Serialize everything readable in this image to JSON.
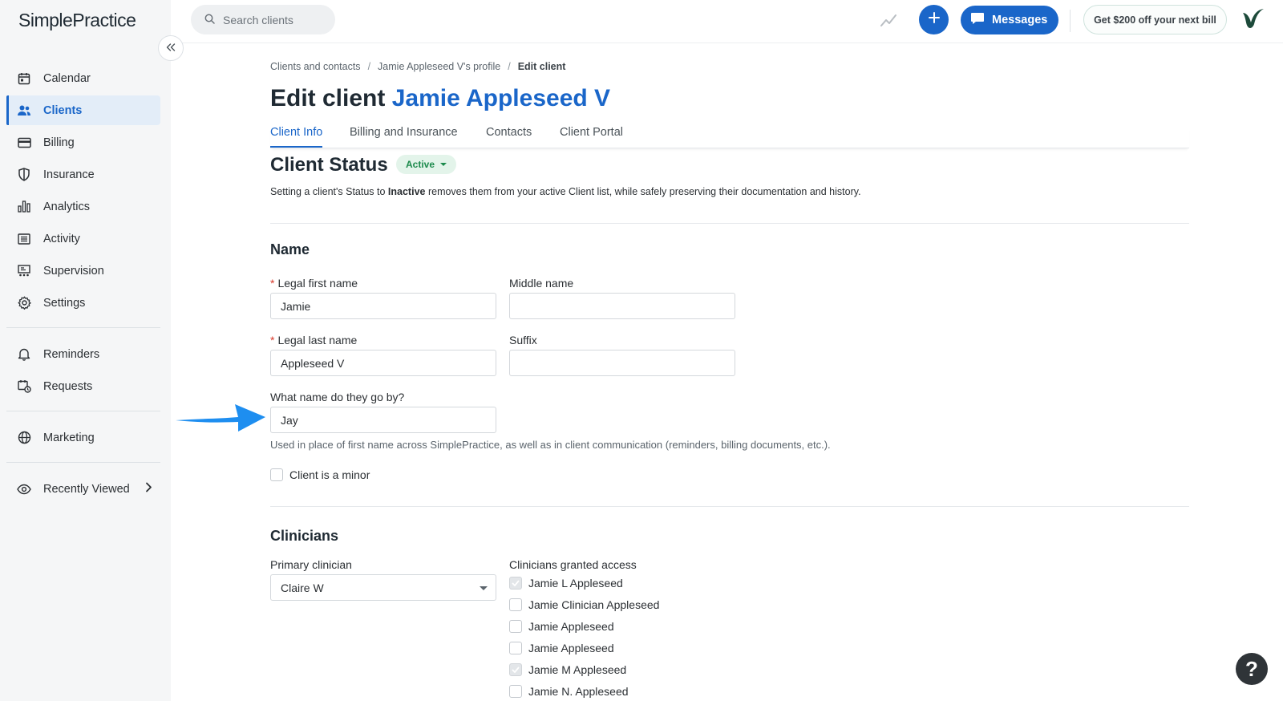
{
  "app": {
    "logo": "SimplePractice",
    "search_placeholder": "Search clients",
    "messages_label": "Messages",
    "promo_label": "Get $200 off your next bill",
    "help_label": "?"
  },
  "sidebar": {
    "items": [
      {
        "label": "Calendar",
        "icon": "calendar-icon"
      },
      {
        "label": "Clients",
        "icon": "clients-icon",
        "active": true
      },
      {
        "label": "Billing",
        "icon": "credit-card-icon"
      },
      {
        "label": "Insurance",
        "icon": "shield-icon"
      },
      {
        "label": "Analytics",
        "icon": "bar-chart-icon"
      },
      {
        "label": "Activity",
        "icon": "list-icon"
      },
      {
        "label": "Supervision",
        "icon": "supervision-icon"
      },
      {
        "label": "Settings",
        "icon": "gear-icon"
      }
    ],
    "secondary": [
      {
        "label": "Reminders",
        "icon": "bell-icon"
      },
      {
        "label": "Requests",
        "icon": "calendar-clock-icon"
      }
    ],
    "marketing": {
      "label": "Marketing",
      "icon": "globe-icon"
    },
    "recently_viewed": {
      "label": "Recently Viewed",
      "icon": "eye-icon"
    }
  },
  "breadcrumb": {
    "items": [
      "Clients and contacts",
      "Jamie Appleseed V's profile"
    ],
    "current": "Edit client"
  },
  "page": {
    "title_prefix": "Edit client",
    "client_name": "Jamie Appleseed V"
  },
  "tabs": [
    "Client Info",
    "Billing and Insurance",
    "Contacts",
    "Client Portal"
  ],
  "status": {
    "title": "Client Status",
    "badge": "Active",
    "note_prefix": "Setting a client's Status to ",
    "note_bold": "Inactive",
    "note_suffix": " removes them from your active Client list, while safely preserving their documentation and history."
  },
  "name_section": {
    "title": "Name",
    "legal_first_label": "Legal first name",
    "legal_first_value": "Jamie",
    "middle_label": "Middle name",
    "middle_value": "",
    "legal_last_label": "Legal last name",
    "legal_last_value": "Appleseed V",
    "suffix_label": "Suffix",
    "suffix_value": "",
    "goes_by_label": "What name do they go by?",
    "goes_by_value": "Jay",
    "goes_by_help": "Used in place of first name across SimplePractice, as well as in client communication (reminders, billing documents, etc.).",
    "minor_label": "Client is a minor"
  },
  "clinicians": {
    "title": "Clinicians",
    "primary_label": "Primary clinician",
    "primary_value": "Claire W",
    "access_label": "Clinicians granted access",
    "access_list": [
      {
        "name": "Jamie L Appleseed",
        "checked": true
      },
      {
        "name": "Jamie Clinician Appleseed",
        "checked": false
      },
      {
        "name": "Jamie Appleseed",
        "checked": false
      },
      {
        "name": "Jamie Appleseed",
        "checked": false
      },
      {
        "name": "Jamie M Appleseed",
        "checked": true
      },
      {
        "name": "Jamie N. Appleseed",
        "checked": false
      }
    ]
  },
  "colors": {
    "accent": "#1a66c9",
    "active_badge_bg": "#e3f4ea",
    "active_badge_text": "#1c8a4c",
    "annotation_arrow": "#1e8ef0"
  }
}
